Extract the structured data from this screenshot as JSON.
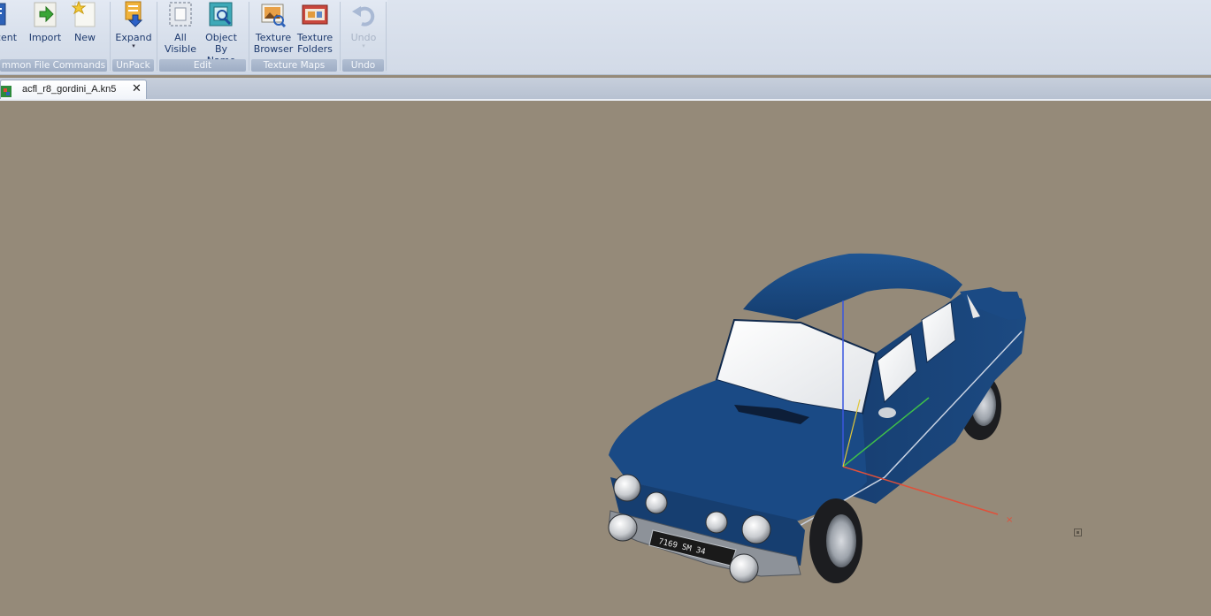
{
  "ribbon": {
    "buttons": [
      {
        "label1": "cent",
        "label2": "",
        "icon": "recent-icon"
      },
      {
        "label1": "Import",
        "label2": "",
        "icon": "import-arrow-icon"
      },
      {
        "label1": "New",
        "label2": "",
        "icon": "new-file-icon"
      },
      {
        "label1": "Expand",
        "label2": "",
        "icon": "expand-icon",
        "dropdown": "▾"
      },
      {
        "label1": "All",
        "label2": "Visible",
        "icon": "all-visible-icon"
      },
      {
        "label1": "Object",
        "label2": "By Name",
        "icon": "object-by-name-icon"
      },
      {
        "label1": "Texture",
        "label2": "Browser",
        "icon": "texture-browser-icon"
      },
      {
        "label1": "Texture",
        "label2": "Folders",
        "icon": "texture-folders-icon"
      },
      {
        "label1": "Undo",
        "label2": "",
        "icon": "undo-icon",
        "dropdown": "▾",
        "disabled": true
      }
    ],
    "groups": [
      {
        "label": "mmon File Commands"
      },
      {
        "label": "UnPack"
      },
      {
        "label": "Edit"
      },
      {
        "label": "Texture Maps"
      },
      {
        "label": "Undo"
      }
    ]
  },
  "tabs": [
    {
      "label": "acfl_r8_gordini_A.kn5",
      "close": "✕",
      "icon": "kn5-file-icon",
      "active": true
    }
  ],
  "viewport": {
    "background": "#958a79",
    "model": "car-3d-model",
    "car_color": "#1d4a82",
    "license_plate": "7169 SM 34",
    "gizmo_axes": [
      "x",
      "y",
      "z"
    ],
    "gizmo_colors": {
      "x": "#e0503a",
      "y": "#3fbf4a",
      "z": "#3a56e0"
    }
  }
}
